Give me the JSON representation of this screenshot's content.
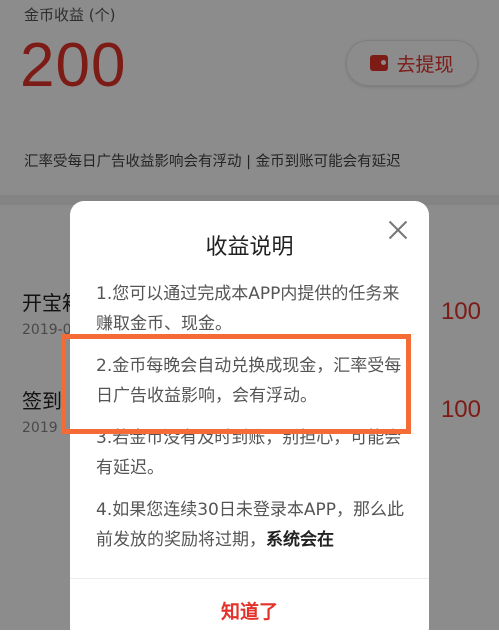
{
  "header": {
    "coin_label": "金币收益 (个)",
    "coin_amount": "200",
    "withdraw_label": "去提现"
  },
  "notice": "汇率受每日广告收益影响会有浮动 | 金币到账可能会有延迟",
  "records": [
    {
      "title": "开宝箱",
      "date": "2019-0",
      "value": "100"
    },
    {
      "title": "签到",
      "date": "2019",
      "value": "100"
    }
  ],
  "modal": {
    "title": "收益说明",
    "paragraphs": [
      "1.您可以通过完成本APP内提供的任务来赚取金币、现金。",
      "2.金币每晚会自动兑换成现金，汇率受每日广告收益影响，会有浮动。",
      "3.若金币没有及时到账，别担心，可能会有延迟。"
    ],
    "paragraph4_normal": "4.如果您连续30日未登录本APP，那么此前发放的奖励将过期，",
    "paragraph4_bold": "系统会在",
    "ok_label": "知道了"
  },
  "colors": {
    "accent": "#e4322b",
    "highlight": "#f56b35"
  }
}
